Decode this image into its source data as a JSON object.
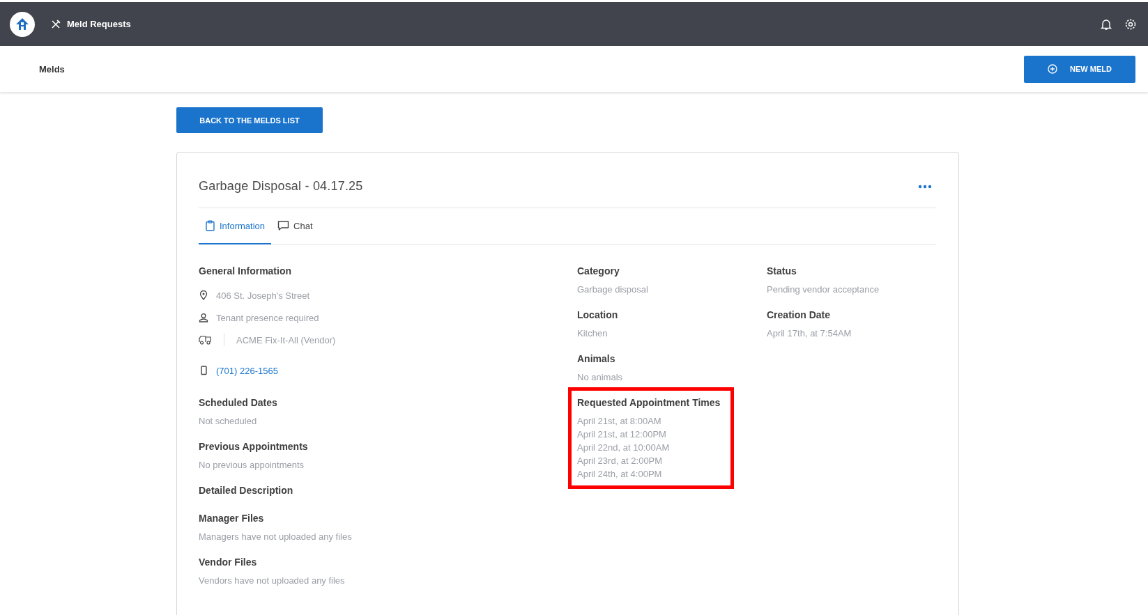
{
  "topbar": {
    "title": "Meld Requests"
  },
  "subheader": {
    "title": "Melds",
    "new_button": "NEW MELD"
  },
  "back_button": "BACK TO THE MELDS LIST",
  "card": {
    "title": "Garbage Disposal - 04.17.25",
    "tabs": [
      {
        "label": "Information",
        "selected": true
      },
      {
        "label": "Chat",
        "selected": false
      }
    ],
    "general": {
      "heading": "General Information",
      "address": "406 St. Joseph's Street",
      "tenant": "Tenant presence required",
      "vendor": "ACME Fix-It-All (Vendor)",
      "phone": "(701) 226-1565"
    },
    "left_sections": [
      {
        "heading": "Scheduled Dates",
        "value": "Not scheduled"
      },
      {
        "heading": "Previous Appointments",
        "value": "No previous appointments"
      },
      {
        "heading": "Detailed Description"
      },
      {
        "heading": "Manager Files",
        "value": "Managers have not uploaded any files"
      },
      {
        "heading": "Vendor Files",
        "value": "Vendors have not uploaded any files"
      }
    ],
    "middle_sections": [
      {
        "heading": "Category",
        "value": "Garbage disposal"
      },
      {
        "heading": "Location",
        "value": "Kitchen"
      },
      {
        "heading": "Animals",
        "value": "No animals"
      }
    ],
    "requested": {
      "heading": "Requested Appointment Times",
      "highlighted": true,
      "times": [
        "April 21st, at 8:00AM",
        "April 21st, at 12:00PM",
        "April 22nd, at 10:00AM",
        "April 23rd, at 2:00PM",
        "April 24th, at 4:00PM"
      ]
    },
    "right_sections": [
      {
        "heading": "Status",
        "value": "Pending vendor acceptance"
      },
      {
        "heading": "Creation Date",
        "value": "April 17th, at 7:54AM"
      }
    ]
  }
}
